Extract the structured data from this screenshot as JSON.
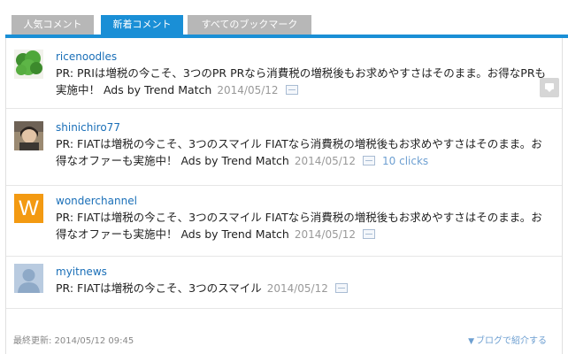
{
  "tabs": [
    {
      "label": "人気コメント",
      "active": false
    },
    {
      "label": "新着コメント",
      "active": true
    },
    {
      "label": "すべてのブックマーク",
      "active": false
    }
  ],
  "entries": [
    {
      "user": "ricenoodles",
      "avatar": "broccoli-image",
      "comment": "PR: PRIは増税の今こそ、3つのPR PRなら消費税の増税後もお求めやすさはそのまま。お得なPRも実施中！ Ads by Trend Match",
      "date": "2014/05/12",
      "clicks": ""
    },
    {
      "user": "shinichiro77",
      "avatar": "person-photo",
      "comment": "PR: FIATは増税の今こそ、3つのスマイル FIATなら消費税の増税後もお求めやすさはそのまま。お得なオファーも実施中！ Ads by Trend Match",
      "date": "2014/05/12",
      "clicks": "10 clicks"
    },
    {
      "user": "wonderchannel",
      "avatar": "w-logo",
      "avatar_letter": "W",
      "comment": "PR: FIATは増税の今こそ、3つのスマイル FIATなら消費税の増税後もお求めやすさはそのまま。お得なオファーも実施中！ Ads by Trend Match",
      "date": "2014/05/12",
      "clicks": ""
    },
    {
      "user": "myitnews",
      "avatar": "default-user-silhouette",
      "comment": "PR: FIATは増税の今こそ、3つのスマイル",
      "date": "2014/05/12",
      "clicks": ""
    }
  ],
  "footer": {
    "updated": "最終更新: 2014/05/12 09:45",
    "share": "ブログで紹介する"
  },
  "colors": {
    "accent": "#1a8fd6",
    "tab_inactive": "#b7b7b7",
    "link": "#1a6fb8",
    "w_logo": "#f39a12"
  }
}
